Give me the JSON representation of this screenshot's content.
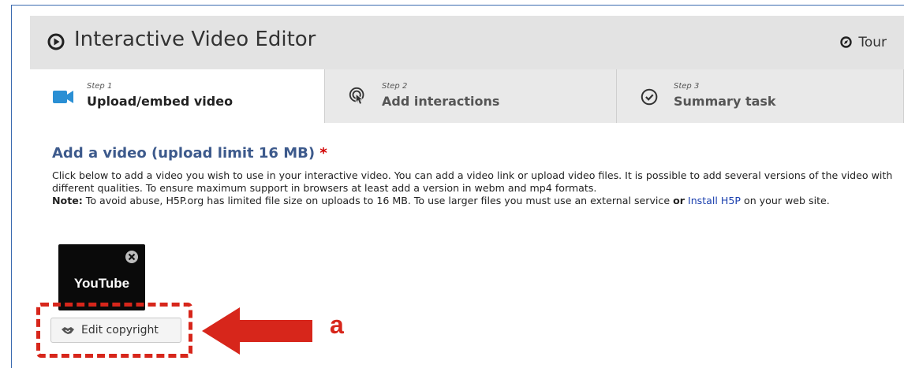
{
  "header": {
    "title": "Interactive Video Editor",
    "tour_label": "Tour"
  },
  "tabs": [
    {
      "step": "Step 1",
      "label": "Upload/embed video",
      "icon": "video-camera-icon",
      "active": true
    },
    {
      "step": "Step 2",
      "label": "Add interactions",
      "icon": "touch-pointer-icon",
      "active": false
    },
    {
      "step": "Step 3",
      "label": "Summary task",
      "icon": "check-circle-icon",
      "active": false
    }
  ],
  "section": {
    "title": "Add a video (upload limit 16 MB)",
    "required_mark": "*",
    "desc_line1": "Click below to add a video you wish to use in your interactive video. You can add a video link or upload video files. It is possible to add several versions of the video with different qualities. To ensure maximum support in browsers at least add a version in webm and mp4 formats.",
    "note_label": "Note:",
    "note_text_1": " To avoid abuse, H5P.org has limited file size on uploads to 16 MB. To use larger files you must use an external service ",
    "note_or": "or",
    "note_link": "Install H5P",
    "note_text_2": " on your web site."
  },
  "video_item": {
    "label": "YouTube"
  },
  "copyright_button": {
    "label": "Edit copyright"
  },
  "annotation": {
    "label": "a"
  },
  "colors": {
    "accent_title": "#3d5a8c",
    "annotation_red": "#d7261b",
    "link": "#1a3fae",
    "video_icon": "#2a8fd4"
  }
}
